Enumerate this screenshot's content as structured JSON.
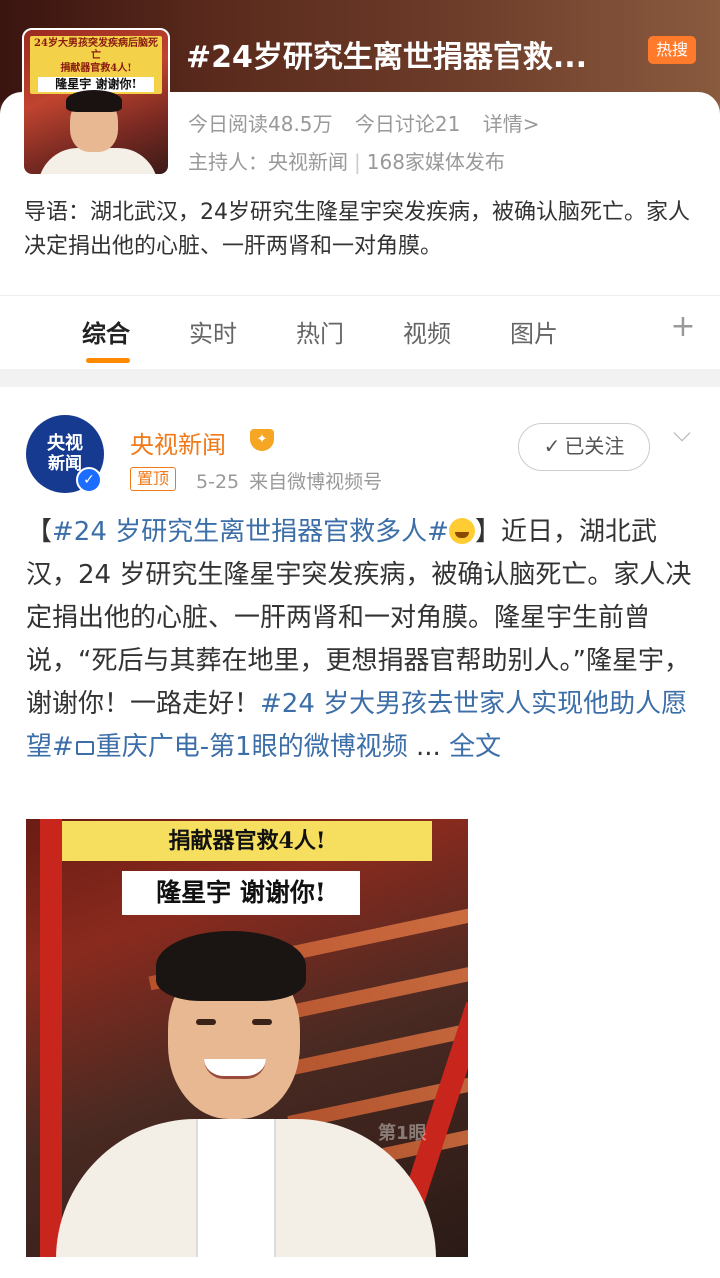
{
  "topic": {
    "title": "#24岁研究生离世捐器官救...",
    "hot_badge": "热搜",
    "stats": {
      "reads": "今日阅读48.5万",
      "discussions": "今日讨论21",
      "detail": "详情>"
    },
    "host_label": "主持人：",
    "host_name": "央视新闻",
    "separator": "|",
    "media_count": "168家媒体发布",
    "intro": "导语：湖北武汉，24岁研究生隆星宇突发疾病，被确认脑死亡。家人决定捐出他的心脏、一肝两肾和一对角膜。",
    "thumbnail": {
      "line1": "24岁大男孩突发疾病后脑死亡",
      "line2": "捐献器官救4人!",
      "line3": "隆星宇 谢谢你!"
    }
  },
  "tabs": [
    {
      "label": "综合",
      "active": true
    },
    {
      "label": "实时",
      "active": false
    },
    {
      "label": "热门",
      "active": false
    },
    {
      "label": "视频",
      "active": false
    },
    {
      "label": "图片",
      "active": false
    }
  ],
  "tabs_extra": {
    "plus": "+"
  },
  "post": {
    "avatar": {
      "line1": "央视",
      "line2": "新闻",
      "verify": "✓"
    },
    "author": "央视新闻",
    "pinned": "置顶",
    "date": "5-25",
    "source": "来自微博视频号",
    "follow_label": "已关注",
    "follow_check": "✓",
    "text": {
      "open_bracket": "【",
      "topic_tag": "#24 岁研究生离世捐器官救多人#",
      "close_bracket": "】",
      "body": "近日，湖北武汉，24 岁研究生隆星宇突发疾病，被确认脑死亡。家人决定捐出他的心脏、一肝两肾和一对角膜。隆星宇生前曾说，“死后与其葬在地里，更想捐器官帮助别人。”隆星宇，谢谢你！一路走好！",
      "tag2": "#24 岁大男孩去世家人实现他助人愿望#",
      "video_link": "重庆广电-第1眼的微博视频",
      "ellipsis": " ... ",
      "full_text": "全文"
    },
    "video": {
      "caption1": "捐献器官救4人!",
      "caption2": "隆星宇 谢谢你!",
      "watermark": "第1眼"
    }
  },
  "colors": {
    "accent_orange": "#f07a1a",
    "link_blue": "#3c6ea8",
    "hot_badge": "#ff7a2a",
    "tab_underline": "#ff8a00"
  }
}
